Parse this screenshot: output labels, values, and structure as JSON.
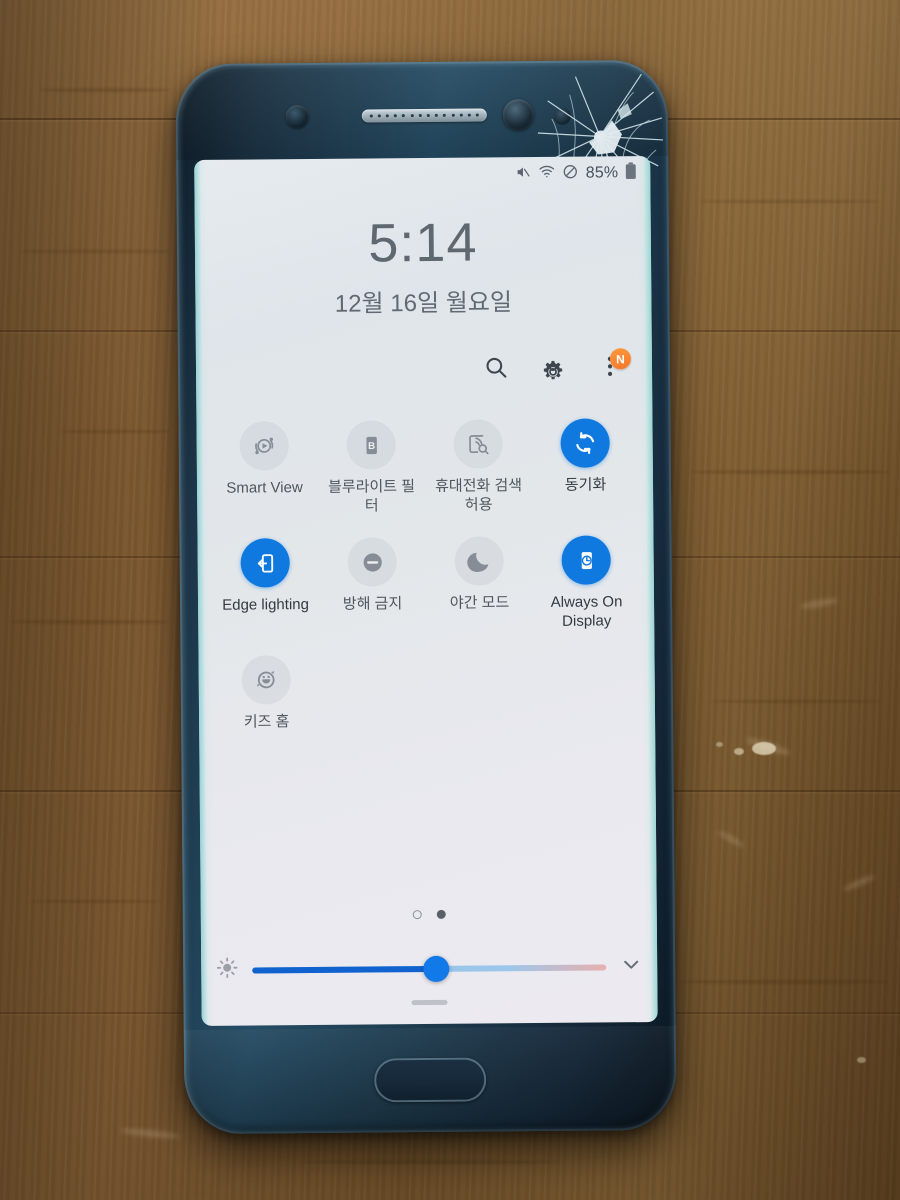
{
  "scene": {
    "subject": "Samsung Galaxy Note 7 smartphone on a wooden table",
    "background_color": "#8a6234",
    "phone_body_color": "#1c3446",
    "screen_background_color": "#e4e9ed",
    "accent_color": "#1079e0",
    "damage_note": "cracked glass at top-right corner"
  },
  "status_bar": {
    "icons": [
      "mute-icon",
      "wifi-icon",
      "do-not-disturb-icon"
    ],
    "battery_percent": "85%",
    "battery_icon": "battery-icon"
  },
  "clock": {
    "time": "5:14",
    "date": "12월 16일 월요일"
  },
  "quick_panel_header": {
    "buttons": [
      {
        "name": "search-icon",
        "label": "검색"
      },
      {
        "name": "settings-gear-icon",
        "label": "설정"
      },
      {
        "name": "more-options-icon",
        "label": "더보기",
        "badge": "N"
      }
    ]
  },
  "toggles": [
    {
      "label": "Smart View",
      "icon": "smart-view-icon",
      "state": "off"
    },
    {
      "label": "블루라이트 필터",
      "icon": "blue-light-filter-icon",
      "state": "off"
    },
    {
      "label": "휴대전화 검색 허용",
      "icon": "phone-search-icon",
      "state": "off"
    },
    {
      "label": "동기화",
      "icon": "sync-icon",
      "state": "on"
    },
    {
      "label": "Edge lighting",
      "icon": "edge-lighting-icon",
      "state": "on"
    },
    {
      "label": "방해 금지",
      "icon": "do-not-disturb-icon",
      "state": "off"
    },
    {
      "label": "야간 모드",
      "icon": "night-mode-moon-icon",
      "state": "off"
    },
    {
      "label": "Always On Display",
      "icon": "always-on-display-icon",
      "state": "on"
    },
    {
      "label": "키즈 홈",
      "icon": "kids-home-icon",
      "state": "off"
    }
  ],
  "pager": {
    "pages": 2,
    "active_page": 2
  },
  "brightness": {
    "icon": "brightness-sun-icon",
    "value_percent": 52,
    "expand_icon": "chevron-down-icon"
  },
  "hardware": {
    "iris_scanner": "iris-scanner",
    "earpiece": "earpiece-speaker",
    "front_camera": "front-camera",
    "proximity_sensor": "proximity-sensor",
    "home_button": "home-button"
  }
}
